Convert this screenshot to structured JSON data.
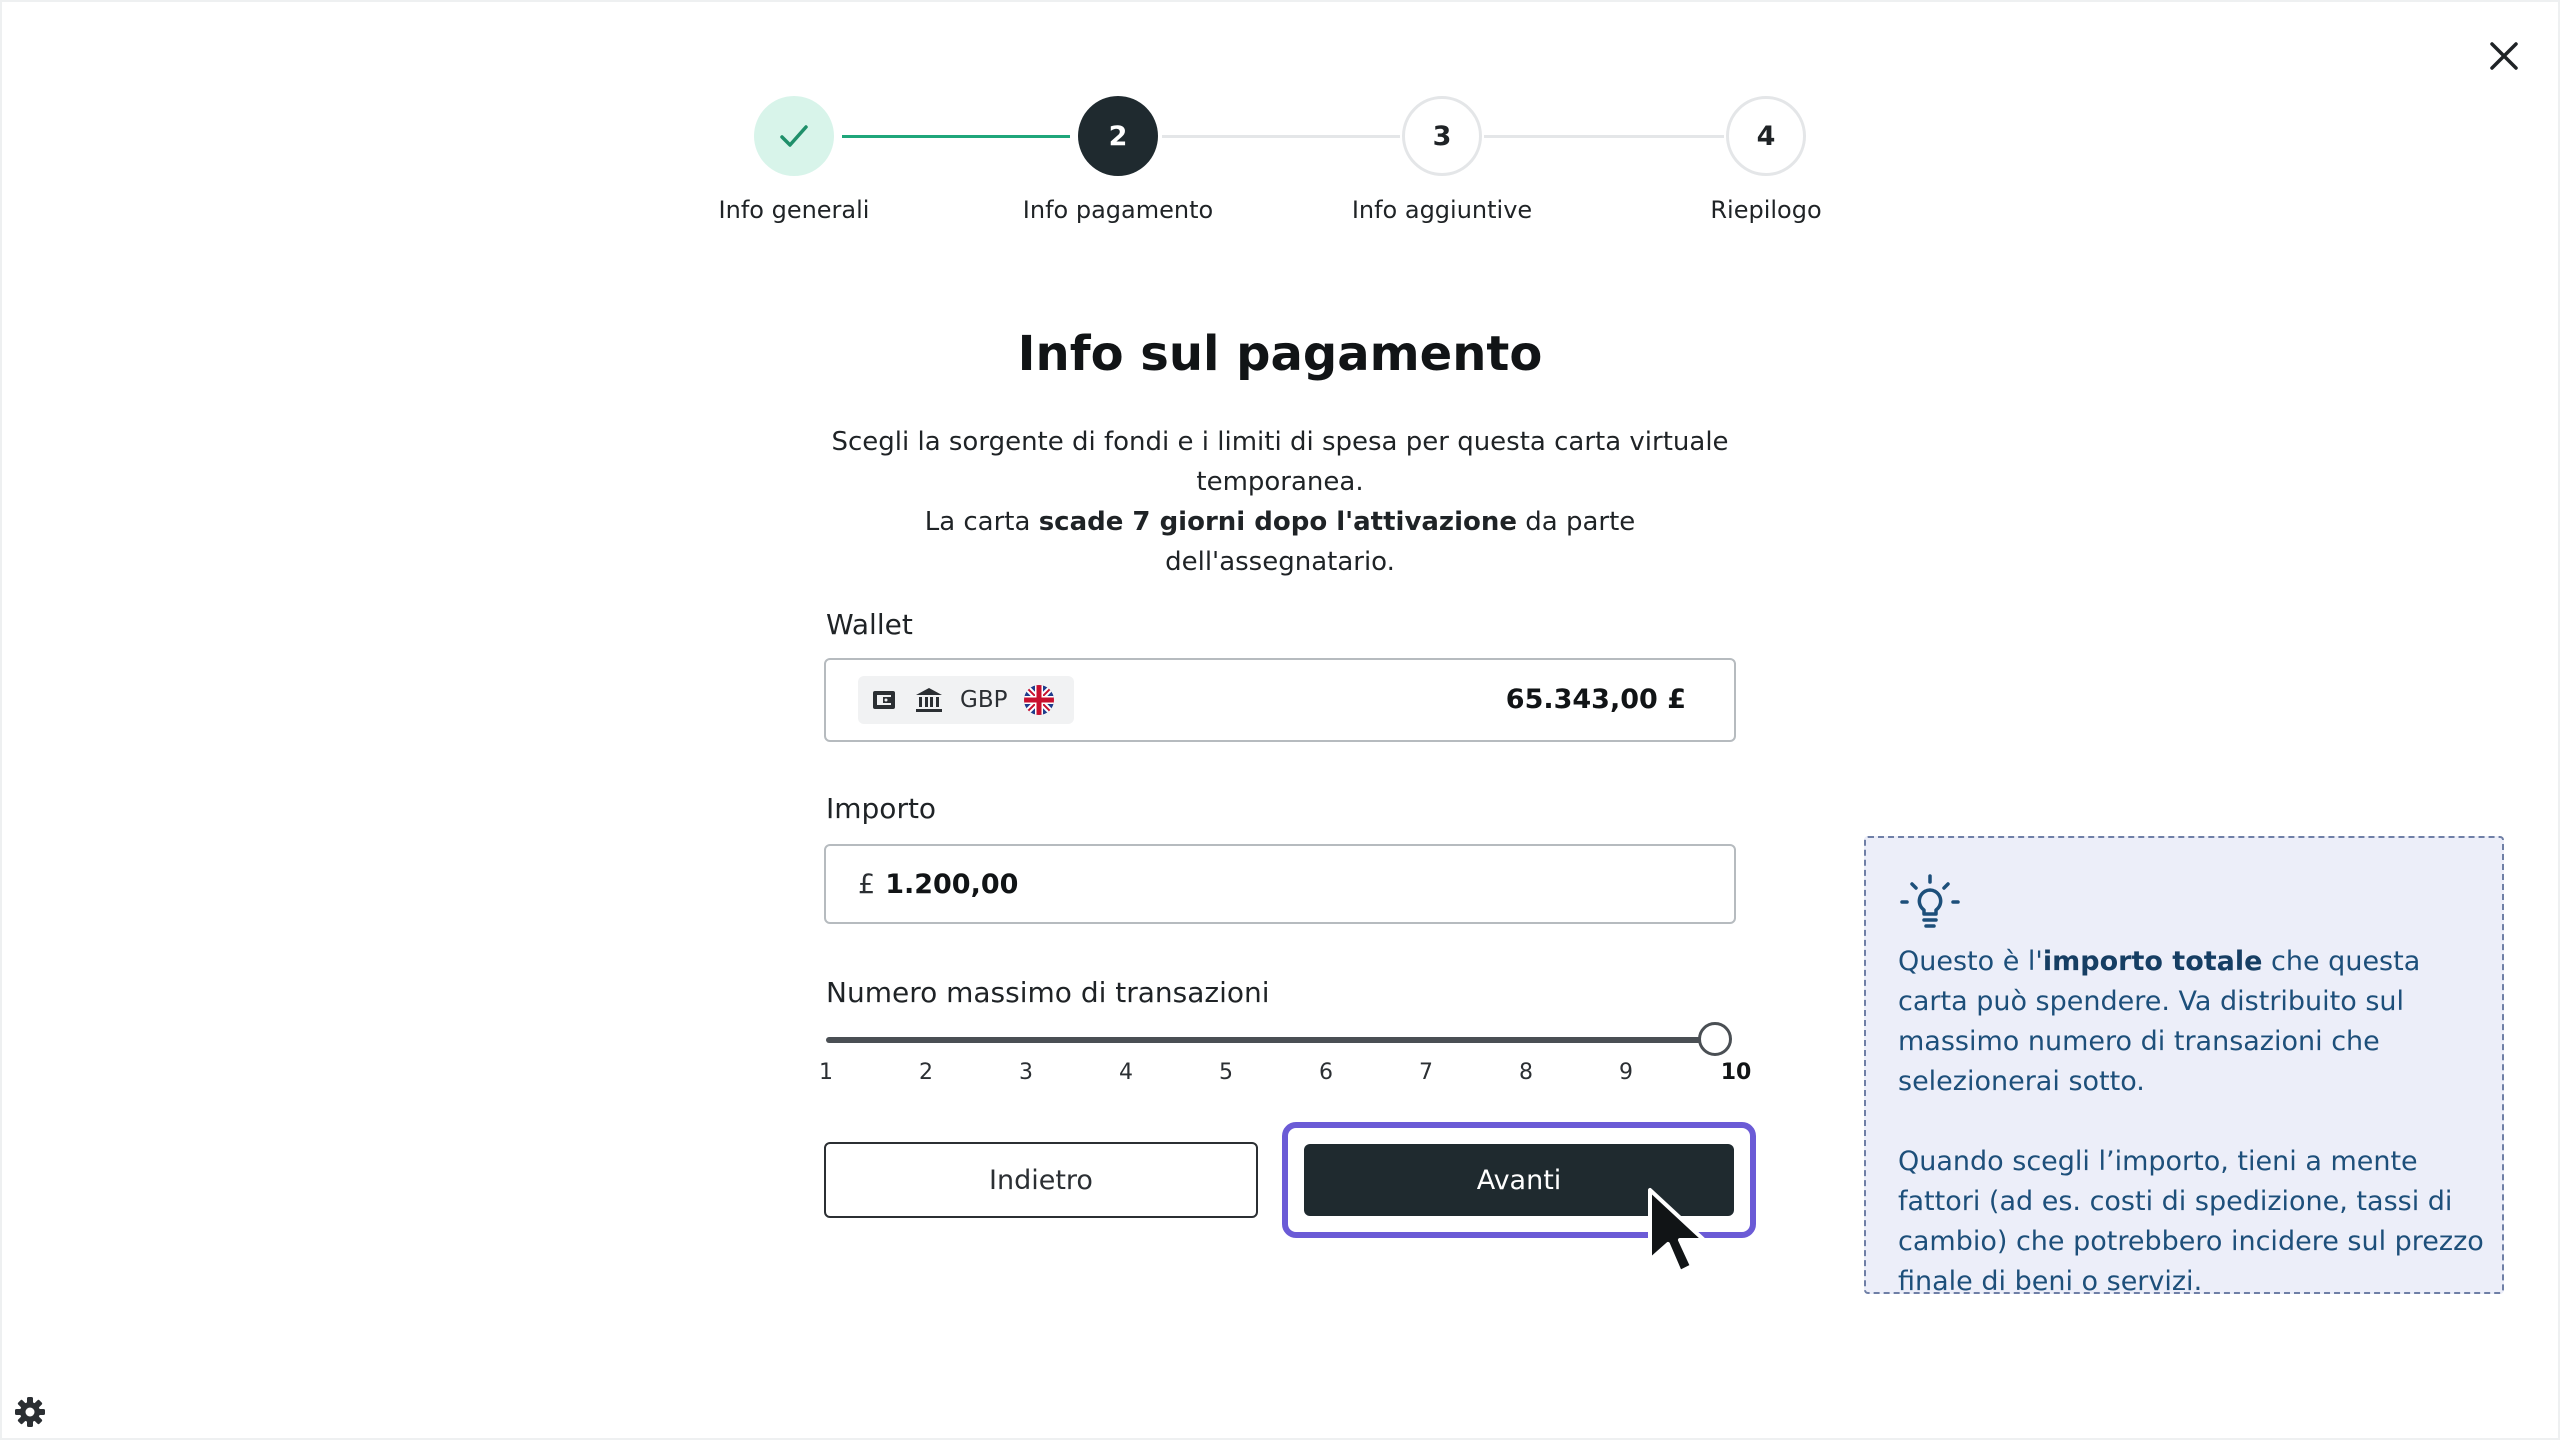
{
  "stepper": {
    "steps": [
      {
        "label": "Info generali",
        "number": "1",
        "status": "complete"
      },
      {
        "label": "Info pagamento",
        "number": "2",
        "status": "active"
      },
      {
        "label": "Info aggiuntive",
        "number": "3",
        "status": "upcoming"
      },
      {
        "label": "Riepilogo",
        "number": "4",
        "status": "upcoming"
      }
    ]
  },
  "page": {
    "title": "Info sul pagamento",
    "description_line1": "Scegli la sorgente di fondi e i limiti di spesa per questa carta virtuale temporanea.",
    "description_line2_prefix": "La carta ",
    "description_line2_bold": "scade 7 giorni dopo l'attivazione",
    "description_line2_suffix": " da parte dell'assegnatario."
  },
  "wallet": {
    "label": "Wallet",
    "currency": "GBP",
    "balance": "65.343,00 £",
    "icons": [
      "wallet-icon",
      "bank-icon",
      "uk-flag-icon"
    ]
  },
  "amount": {
    "label": "Importo",
    "prefix": "£",
    "value": "1.200,00"
  },
  "transactions": {
    "label": "Numero massimo di transazioni",
    "ticks": [
      "1",
      "2",
      "3",
      "4",
      "5",
      "6",
      "7",
      "8",
      "9",
      "10"
    ],
    "min": 1,
    "max": 10,
    "selected": 10
  },
  "buttons": {
    "back": "Indietro",
    "next": "Avanti"
  },
  "tip": {
    "icon": "lightbulb-icon",
    "p1_prefix": "Questo è l'",
    "p1_bold": "importo totale",
    "p1_suffix": " che questa carta può spendere. Va distribuito sul massimo numero di transazioni che selezionerai sotto.",
    "p2": "Quando scegli l’importo, tieni a mente fattori (ad es. costi di spedizione, tassi di cambio) che potrebbero incidere sul prezzo finale di beni o servizi."
  },
  "colors": {
    "accent_dark": "#1f2a2f",
    "success": "#1fa67a",
    "focus": "#6b5bd6",
    "tip_background": "#eceef9",
    "tip_text": "#1d4f7a"
  }
}
